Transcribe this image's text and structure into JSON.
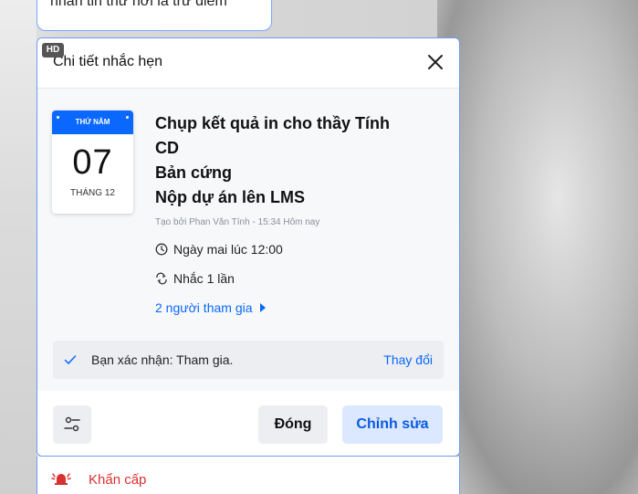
{
  "bubble": {
    "text": "nhắn tin thử hơi là trừ điểm"
  },
  "dialog": {
    "badge": "HD",
    "title": "Chi tiết nhắc hẹn",
    "calendar": {
      "weekday": "THỨ NĂM",
      "day": "07",
      "month": "THÁNG 12"
    },
    "title_lines": [
      "Chụp kết quả in cho thầy Tính",
      "CD",
      "Bản cứng",
      "Nộp dự án lên LMS"
    ],
    "meta": "Tạo bởi Phan Văn Tính - 15:34 Hôm nay",
    "time": "Ngày mai lúc 12:00",
    "repeat": "Nhắc 1 lần",
    "participants": "2 người tham gia",
    "confirm": {
      "text": "Bạn xác nhận: Tham gia.",
      "change": "Thay đổi"
    },
    "buttons": {
      "close": "Đóng",
      "edit": "Chỉnh sửa"
    }
  },
  "urgent": {
    "label": "Khẩn cấp"
  },
  "colors": {
    "accent": "#0a68ff",
    "urgent": "#d93030",
    "border": "#6b9cf2"
  },
  "icons": [
    "close-icon",
    "clock-icon",
    "repeat-icon",
    "caret-right-icon",
    "check-icon",
    "settings-sliders-icon",
    "alarm-bell-icon"
  ]
}
